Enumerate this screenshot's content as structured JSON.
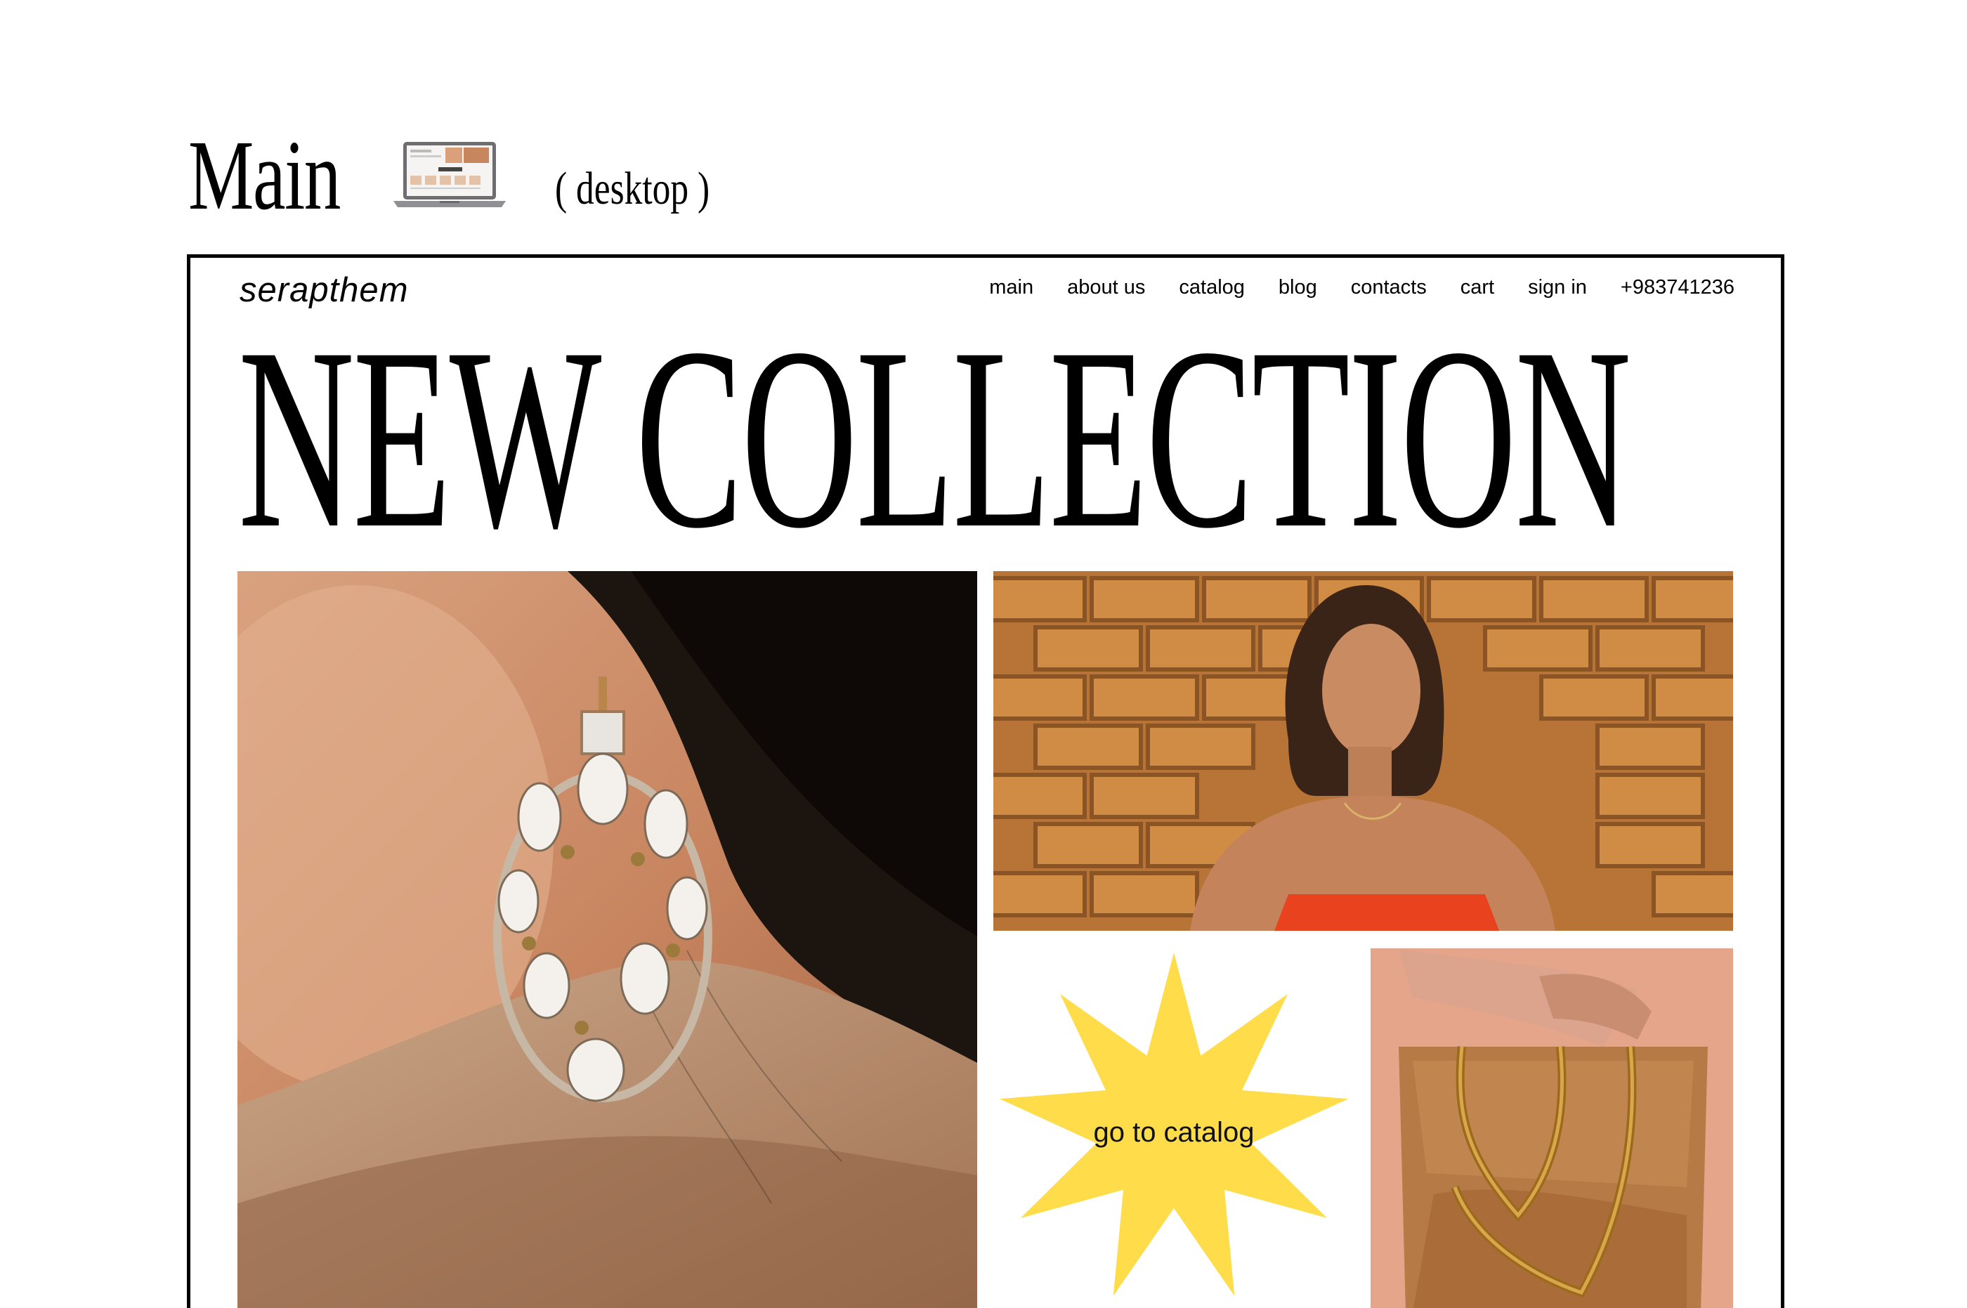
{
  "presentation": {
    "title": "Main",
    "subtitle": "( desktop )",
    "device_icon": "laptop-icon"
  },
  "site": {
    "brand": "serapthem",
    "nav": [
      "main",
      "about us",
      "catalog",
      "blog",
      "contacts",
      "cart",
      "sign in",
      "+983741236"
    ],
    "hero_headline": "NEW COLLECTION",
    "cta_label": "go to catalog",
    "colors": {
      "background": "#ffffff",
      "text": "#000000",
      "star": "#FFDD4A"
    },
    "images": [
      "earring-closeup-photo",
      "woman-brick-wall-photo",
      "chain-necklace-on-stone-photo"
    ]
  }
}
